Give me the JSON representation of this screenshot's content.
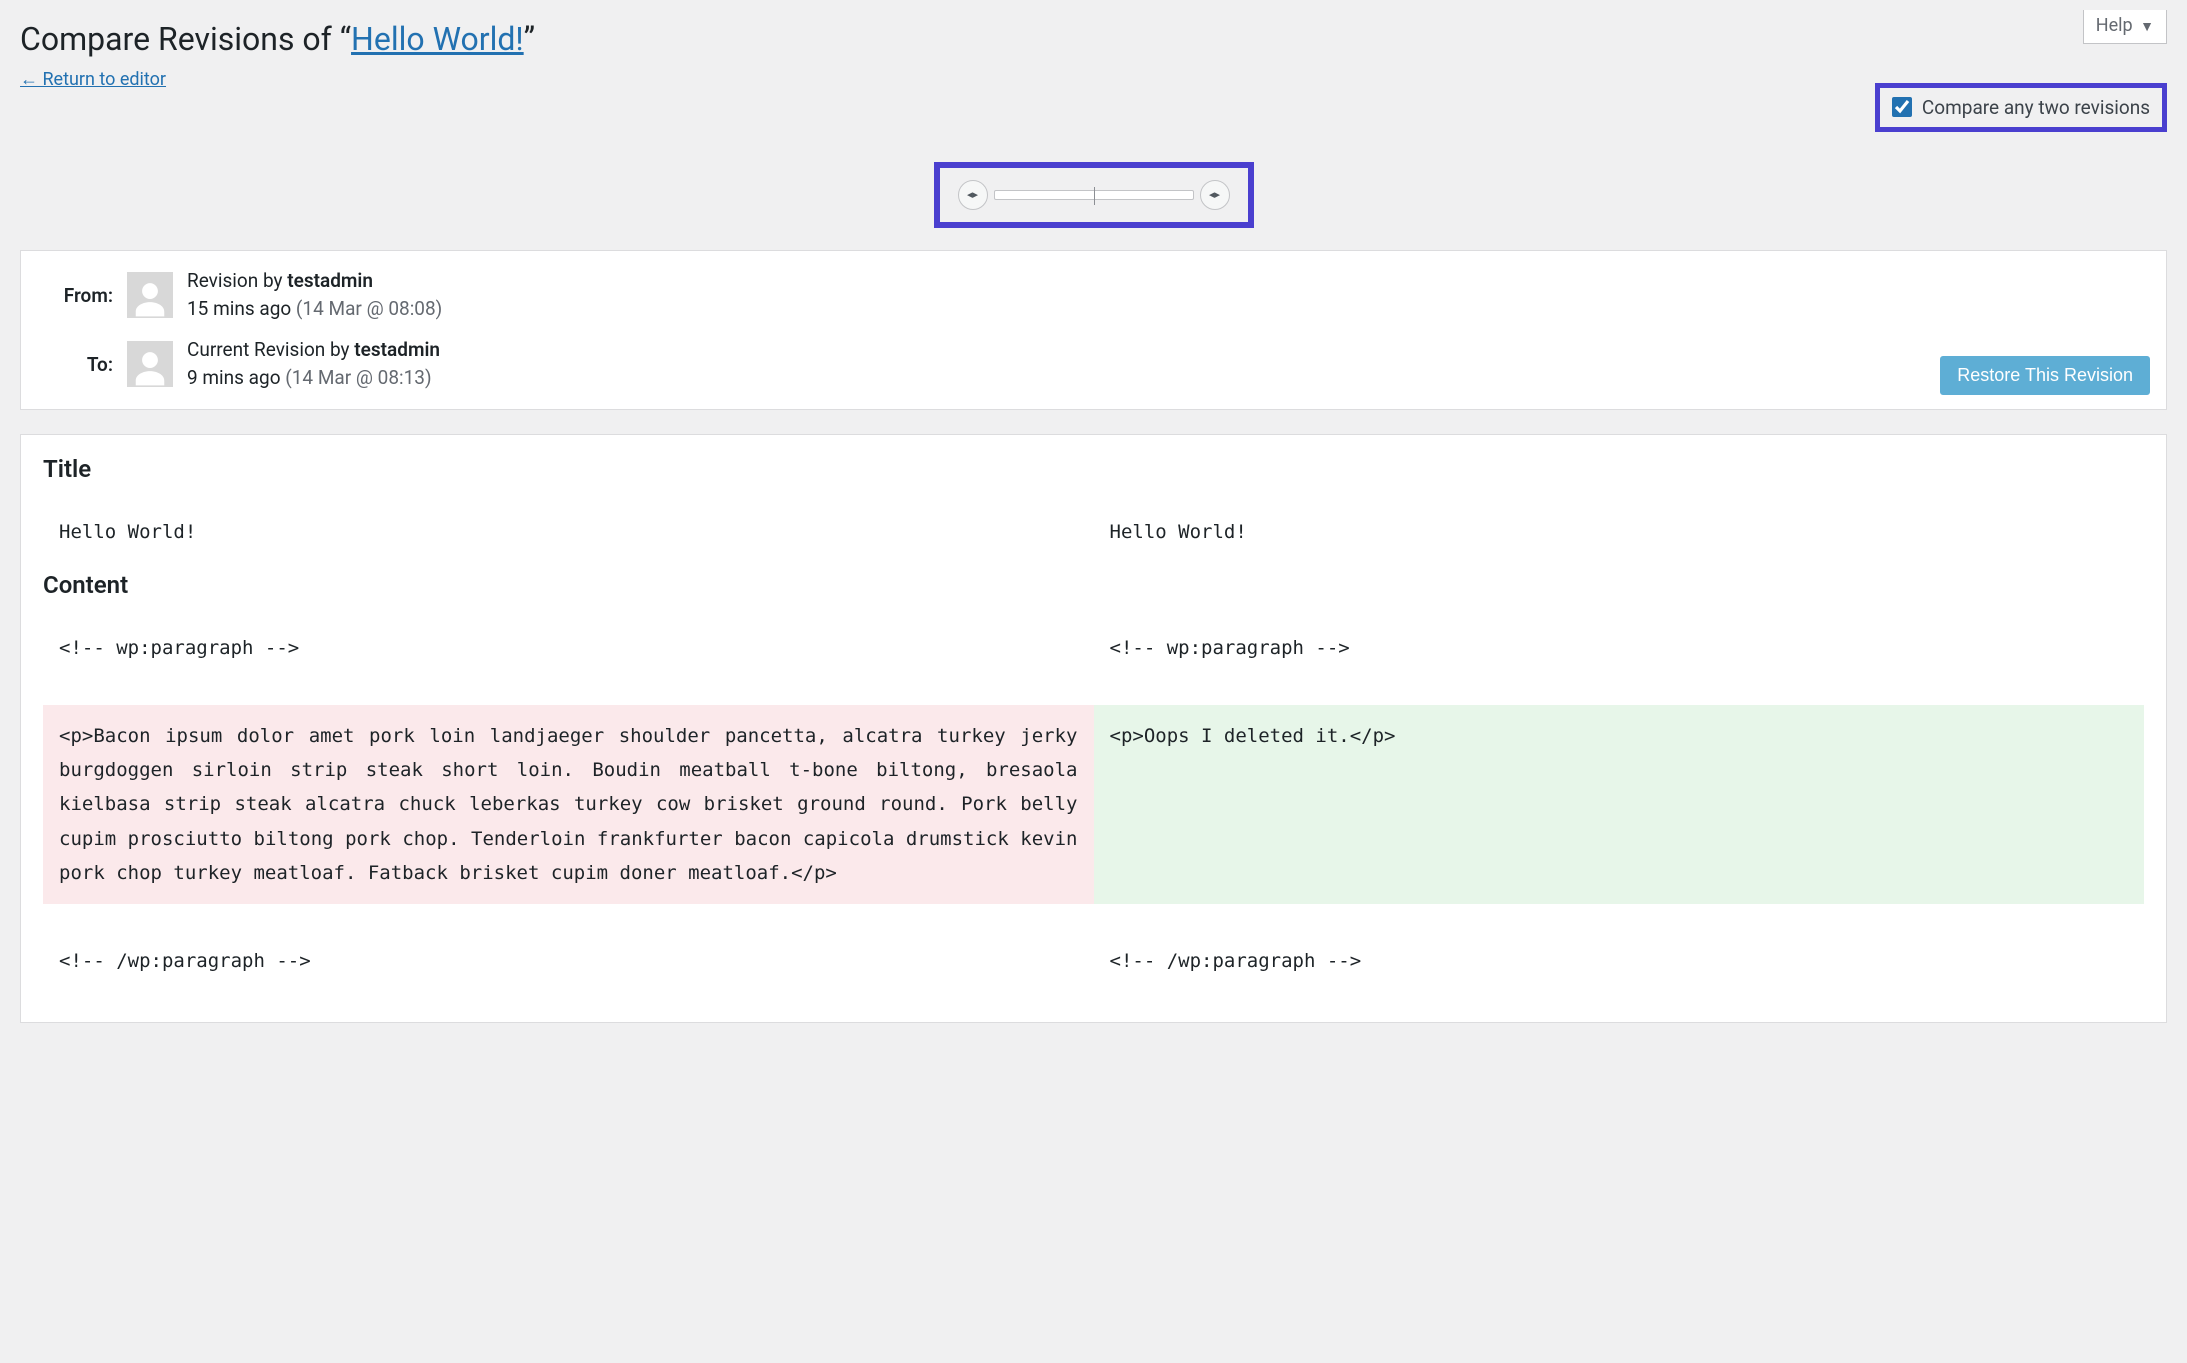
{
  "help_label": "Help",
  "page_heading_prefix": "Compare Revisions of “",
  "page_heading_link": "Hello World!",
  "page_heading_suffix": "”",
  "return_link": "← Return to editor",
  "compare_any_label": "Compare any two revisions",
  "compare_any_checked": true,
  "from": {
    "label": "From:",
    "revision_by": "Revision by",
    "author": "testadmin",
    "time_ago": "15 mins ago",
    "timestamp": "(14 Mar @ 08:08)"
  },
  "to": {
    "label": "To:",
    "revision_by": "Current Revision by",
    "author": "testadmin",
    "time_ago": "9 mins ago",
    "timestamp": "(14 Mar @ 08:13)"
  },
  "restore_button": "Restore This Revision",
  "diff": {
    "title_heading": "Title",
    "title_from": "Hello World!",
    "title_to": "Hello World!",
    "content_heading": "Content",
    "row1_from": "<!-- wp:paragraph -->",
    "row1_to": "<!-- wp:paragraph -->",
    "row2_from": "<p>Bacon ipsum dolor amet pork loin landjaeger shoulder pancetta, alcatra turkey jerky burgdoggen sirloin strip steak short loin. Boudin meatball t-bone biltong, bresaola kielbasa strip steak alcatra chuck leberkas turkey cow brisket ground round. Pork belly cupim prosciutto biltong pork chop. Tenderloin frankfurter bacon capicola drumstick kevin pork chop turkey meatloaf. Fatback brisket cupim doner meatloaf.</p>",
    "row2_to": "<p>Oops I deleted it.</p>",
    "row3_from": "<!-- /wp:paragraph -->",
    "row3_to": "<!-- /wp:paragraph -->"
  }
}
